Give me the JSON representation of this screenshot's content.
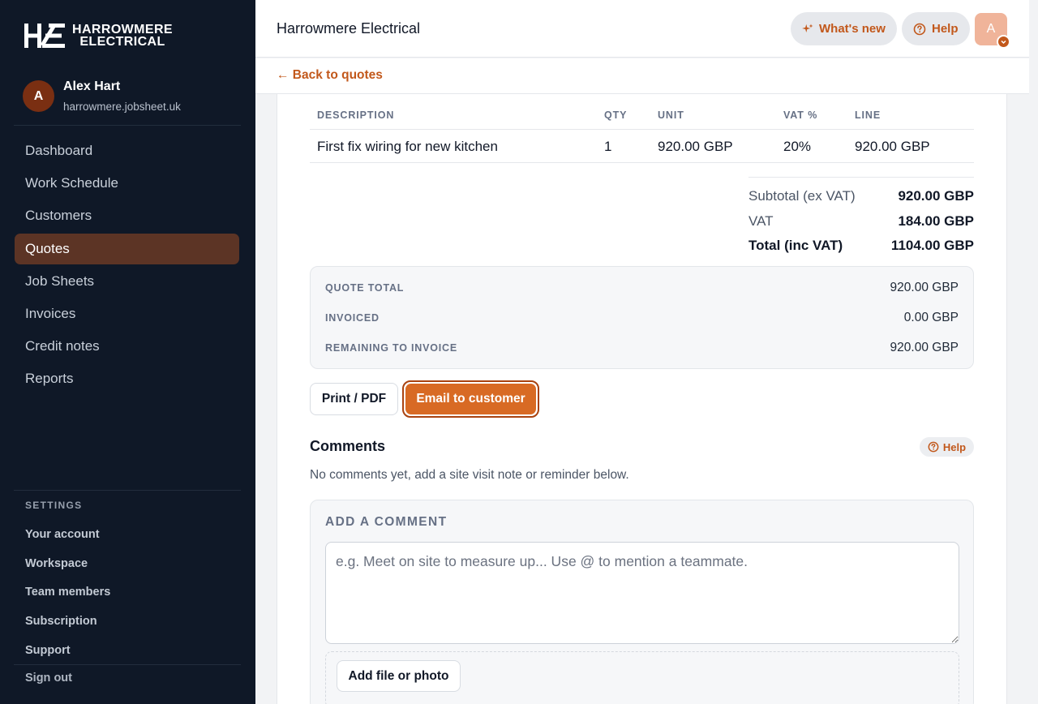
{
  "brand": {
    "logo_line1": "HARROWMERE",
    "logo_line2": "ELECTRICAL"
  },
  "user": {
    "initial": "A",
    "name": "Alex Hart",
    "domain": "harrowmere.jobsheet.uk"
  },
  "nav": {
    "items": [
      {
        "label": "Dashboard",
        "active": false
      },
      {
        "label": "Work Schedule",
        "active": false
      },
      {
        "label": "Customers",
        "active": false
      },
      {
        "label": "Quotes",
        "active": true
      },
      {
        "label": "Job Sheets",
        "active": false
      },
      {
        "label": "Invoices",
        "active": false
      },
      {
        "label": "Credit notes",
        "active": false
      },
      {
        "label": "Reports",
        "active": false
      }
    ]
  },
  "settings": {
    "title": "SETTINGS",
    "items": [
      "Your account",
      "Workspace",
      "Team members",
      "Subscription",
      "Support"
    ],
    "signout": "Sign out"
  },
  "header": {
    "title": "Harrowmere Electrical",
    "whats_new": "What's new",
    "help": "Help",
    "avatar_initial": "A"
  },
  "subbar": {
    "back_link": "← Back to quotes"
  },
  "table": {
    "headers": {
      "description": "DESCRIPTION",
      "qty": "QTY",
      "unit": "UNIT",
      "vat": "VAT %",
      "line": "LINE"
    },
    "rows": [
      {
        "description": "First fix wiring for new kitchen",
        "qty": "1",
        "unit": "920.00 GBP",
        "vat": "20%",
        "line": "920.00 GBP"
      }
    ]
  },
  "totals": {
    "subtotal_label": "Subtotal (ex VAT)",
    "subtotal_value": "920.00 GBP",
    "vat_label": "VAT",
    "vat_value": "184.00 GBP",
    "total_label": "Total (inc VAT)",
    "total_value": "1104.00 GBP"
  },
  "summary": {
    "quote_total_label": "QUOTE TOTAL",
    "quote_total_value": "920.00 GBP",
    "invoiced_label": "INVOICED",
    "invoiced_value": "0.00 GBP",
    "remaining_label": "REMAINING TO INVOICE",
    "remaining_value": "920.00 GBP"
  },
  "actions": {
    "print": "Print / PDF",
    "email": "Email to customer"
  },
  "comments": {
    "title": "Comments",
    "help": "Help",
    "empty": "No comments yet, add a site visit note or reminder below.",
    "add_title": "ADD A COMMENT",
    "placeholder": "e.g. Meet on site to measure up... Use @ to mention a teammate.",
    "attach": "Add file or photo"
  },
  "colors": {
    "accent": "#c2581b",
    "sidebar_bg": "#0f1827",
    "active_nav": "#5c3425",
    "primary_button": "#d86a24"
  }
}
